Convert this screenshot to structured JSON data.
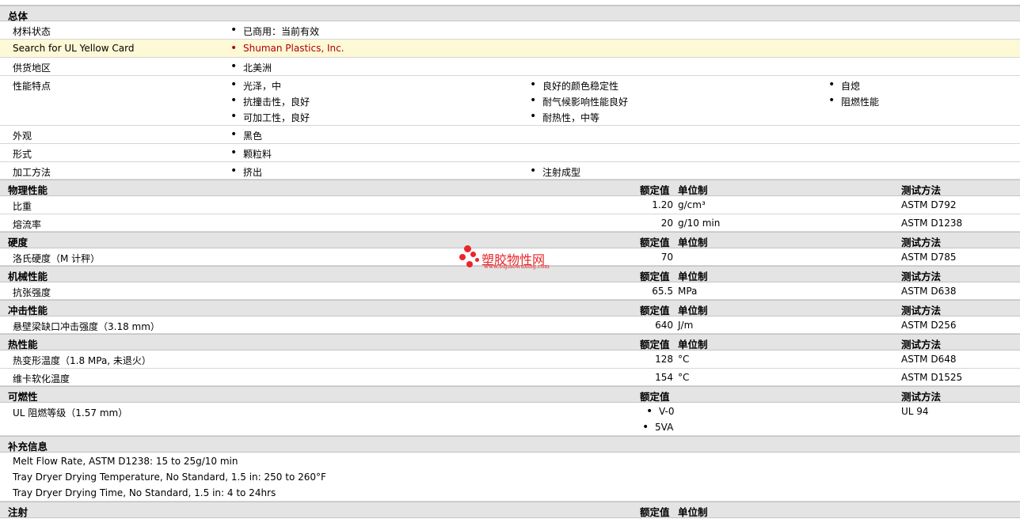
{
  "general": {
    "title": "总体",
    "rows": {
      "status": {
        "label": "材料状态",
        "items": [
          "已商用：当前有效"
        ]
      },
      "yellowcard": {
        "label": "Search for UL Yellow Card",
        "items": [
          "Shuman Plastics, Inc."
        ]
      },
      "region": {
        "label": "供货地区",
        "items": [
          "北美洲"
        ]
      },
      "features": {
        "label": "性能特点",
        "col1": [
          "光泽，中",
          "抗撞击性，良好",
          "可加工性，良好"
        ],
        "col2": [
          "良好的颜色稳定性",
          "耐气候影响性能良好",
          "耐热性，中等"
        ],
        "col3": [
          "自熄",
          "阻燃性能"
        ]
      },
      "appearance": {
        "label": "外观",
        "items": [
          "黑色"
        ]
      },
      "form": {
        "label": "形式",
        "items": [
          "颗粒料"
        ]
      },
      "processing": {
        "label": "加工方法",
        "items": [
          "挤出",
          "注射成型"
        ]
      }
    }
  },
  "headers": {
    "nominal": "额定值",
    "unit": "单位制",
    "method": "测试方法"
  },
  "physical": {
    "title": "物理性能",
    "rows": [
      {
        "label": "比重",
        "value": "1.20",
        "unit": "g/cm³",
        "method": "ASTM D792"
      },
      {
        "label": "熔流率",
        "value": "20",
        "unit": "g/10 min",
        "method": "ASTM D1238"
      }
    ]
  },
  "hardness": {
    "title": "硬度",
    "rows": [
      {
        "label": "洛氏硬度（M 计秤）",
        "value": "70",
        "unit": "",
        "method": "ASTM D785"
      }
    ]
  },
  "mechanical": {
    "title": "机械性能",
    "rows": [
      {
        "label": "抗张强度",
        "value": "65.5",
        "unit": "MPa",
        "method": "ASTM D638"
      }
    ]
  },
  "impact": {
    "title": "冲击性能",
    "rows": [
      {
        "label": "悬壁梁缺口冲击强度（3.18 mm）",
        "value": "640",
        "unit": "J/m",
        "method": "ASTM D256"
      }
    ]
  },
  "thermal": {
    "title": "热性能",
    "rows": [
      {
        "label": "热变形温度（1.8 MPa, 未退火）",
        "value": "128",
        "unit": "°C",
        "method": "ASTM D648"
      },
      {
        "label": "维卡软化温度",
        "value": "154",
        "unit": "°C",
        "method": "ASTM D1525"
      }
    ]
  },
  "flammability": {
    "title": "可燃性",
    "row": {
      "label": "UL 阻燃等级（1.57 mm）",
      "values": [
        "V-0",
        "5VA"
      ],
      "method": "UL 94"
    }
  },
  "supplemental": {
    "title": "补充信息",
    "lines": [
      "Melt Flow Rate, ASTM D1238: 15 to 25g/10 min",
      "Tray Dryer Drying Temperature, No Standard, 1.5 in: 250 to 260°F",
      "Tray Dryer Drying Time, No Standard, 1.5 in: 4 to 24hrs"
    ]
  },
  "injection": {
    "title": "注射"
  },
  "watermark": {
    "text": "塑胶物性网",
    "url": "www.sujiaowuxing.com",
    "color": "#e8262a"
  }
}
